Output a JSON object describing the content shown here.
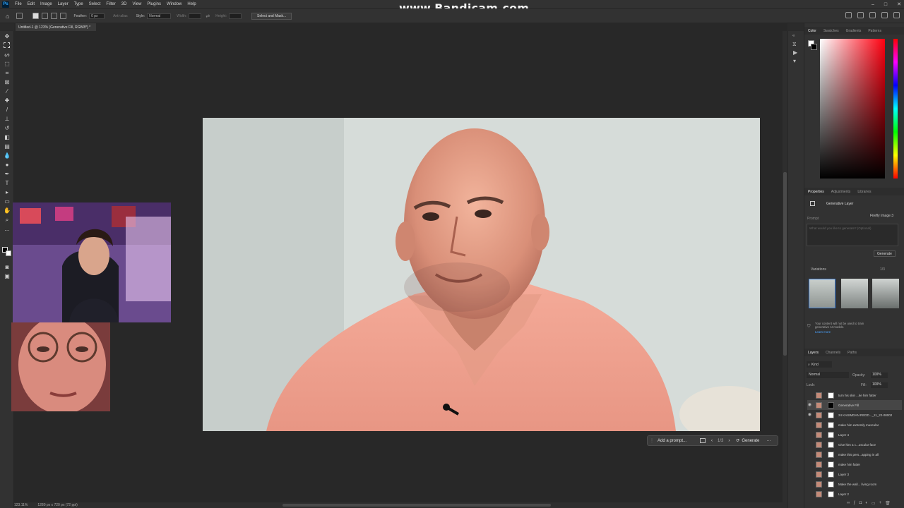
{
  "app": {
    "icon_label": "Ps"
  },
  "menu": [
    "File",
    "Edit",
    "Image",
    "Layer",
    "Type",
    "Select",
    "Filter",
    "3D",
    "View",
    "Plugins",
    "Window",
    "Help"
  ],
  "window_controls": [
    "–",
    "□",
    "✕"
  ],
  "watermark": "www.Bandicam.com",
  "options_bar": {
    "feather_label": "Feather:",
    "feather_value": "0 px",
    "antialias_label": "Anti-alias",
    "style_label": "Style:",
    "style_value": "Normal",
    "width_label": "Width:",
    "height_label": "Height:",
    "select_mask_button": "Select and Mask..."
  },
  "document": {
    "tab_title": "Untitled-1 @ 123% (Generative Fill, RGB/8*) *"
  },
  "status": {
    "zoom": "123.11%",
    "doc_size": "1280 px x 720 px (72 ppi)"
  },
  "contextual_bar": {
    "prompt": "Add a prompt...",
    "counter": "1/3",
    "generate": "Generate"
  },
  "color_panel": {
    "tabs": [
      "Color",
      "Swatches",
      "Gradients",
      "Patterns"
    ],
    "active": 0
  },
  "properties_panel": {
    "tabs": [
      "Properties",
      "Adjustments",
      "Libraries"
    ],
    "layer_type": "Generative Layer",
    "model": "Firefly Image 3",
    "prompt_label": "Prompt",
    "prompt_placeholder": "What would you like to generate? (Optional)",
    "generate_button": "Generate",
    "variations_label": "Variations",
    "variations_count": "1/3",
    "notice": "Your content will not be used to train generative AI models.",
    "learn_more": "Learn more"
  },
  "layers_panel": {
    "tabs": [
      "Layers",
      "Channels",
      "Paths"
    ],
    "filter": "Kind",
    "blend_mode": "Normal",
    "opacity_label": "Opacity:",
    "opacity_value": "100%",
    "lock_label": "Lock:",
    "fill_label": "Fill:",
    "fill_value": "100%",
    "layers": [
      {
        "name": "turn his skin ...ke him fatter",
        "visible": false,
        "selected": false
      },
      {
        "name": "Generative Fill",
        "visible": true,
        "selected": true
      },
      {
        "name": "24 KASIMDAN REDD..._11_22-08002",
        "visible": true,
        "selected": false
      },
      {
        "name": "make him extremly muscular",
        "visible": false,
        "selected": false
      },
      {
        "name": "Layer 4",
        "visible": false,
        "selected": false
      },
      {
        "name": "Give him a c...uscular face",
        "visible": false,
        "selected": false
      },
      {
        "name": "make this pers...apping in all",
        "visible": false,
        "selected": false
      },
      {
        "name": "make him fatter",
        "visible": false,
        "selected": false
      },
      {
        "name": "Layer 3",
        "visible": false,
        "selected": false
      },
      {
        "name": "Make the wall... living room",
        "visible": false,
        "selected": false
      },
      {
        "name": "Layer 2",
        "visible": false,
        "selected": false
      }
    ]
  }
}
